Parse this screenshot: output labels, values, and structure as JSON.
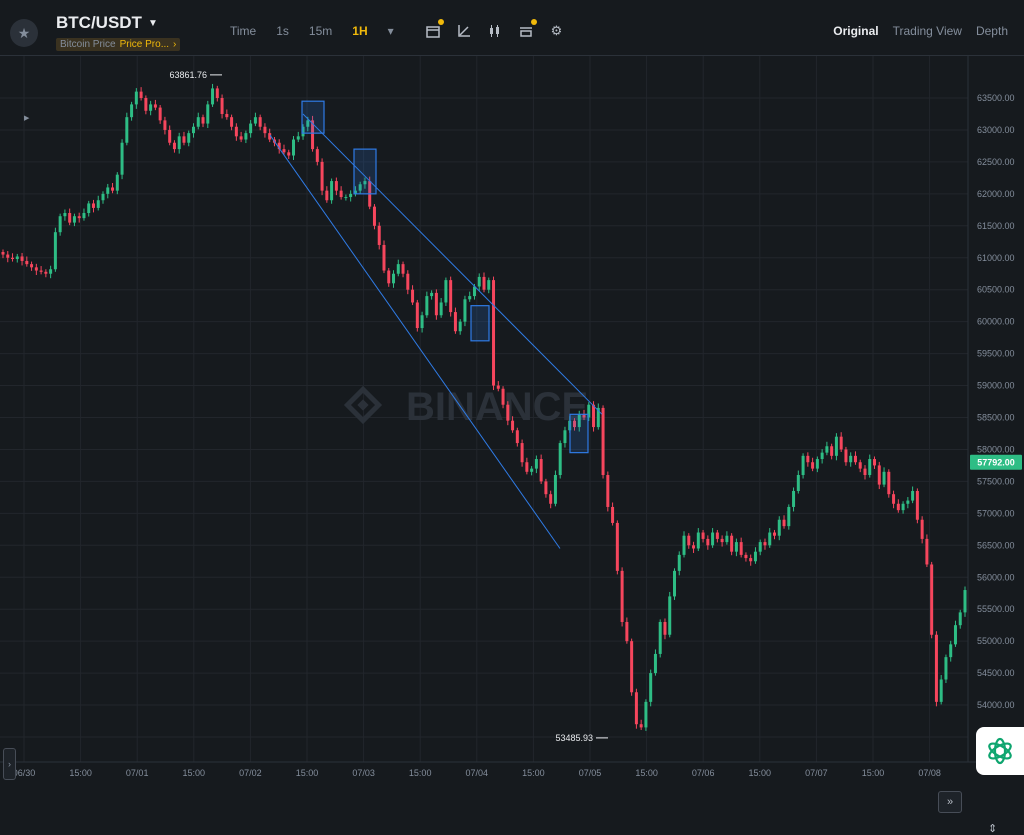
{
  "header": {
    "pair": "BTC/USDT",
    "sub_left": "Bitcoin Price",
    "sub_right": "Price Pro...",
    "intervals": [
      "Time",
      "1s",
      "15m",
      "1H"
    ],
    "active_interval": "1H",
    "views": [
      "Original",
      "Trading View",
      "Depth"
    ],
    "active_view": "Original"
  },
  "icons": {
    "favorite": "star-icon",
    "pair_menu": "caret-down-icon",
    "interval_menu": "caret-down-icon",
    "indicator": "calendar-indicator-icon",
    "drawing": "line-draw-icon",
    "candle_type": "candlestick-icon",
    "template": "template-icon",
    "settings": "gear-icon",
    "fast_forward": "double-chevron-right-icon",
    "scale": "scale-icon",
    "assistant": "ai-assistant-icon"
  },
  "colors": {
    "up": "#2ebd85",
    "down": "#f6465d",
    "accent": "#f0b90b",
    "channel": "#2f7be5"
  },
  "chart_data": {
    "type": "candlestick",
    "symbol": "BTC/USDT",
    "interval": "1H",
    "watermark": "BINANCE",
    "y_ticks": [
      63500,
      63000,
      62500,
      62000,
      61500,
      61000,
      60500,
      60000,
      59500,
      59000,
      58500,
      58000,
      57500,
      57000,
      56500,
      56000,
      55500,
      55000,
      54500,
      54000,
      53500
    ],
    "x_ticks": [
      "06/30",
      "15:00",
      "07/01",
      "15:00",
      "07/02",
      "15:00",
      "07/03",
      "15:00",
      "07/04",
      "15:00",
      "07/05",
      "15:00",
      "07/06",
      "15:00",
      "07/07",
      "15:00",
      "07/08"
    ],
    "high_label": "63861.76",
    "low_label": "53485.93",
    "last_price": "57792.00",
    "close_series": [
      61050,
      61000,
      60980,
      61020,
      60950,
      60900,
      60850,
      60800,
      60780,
      60750,
      60820,
      61400,
      61650,
      61700,
      61550,
      61650,
      61620,
      61700,
      61850,
      61780,
      61900,
      62000,
      62100,
      62050,
      62300,
      62800,
      63200,
      63400,
      63600,
      63500,
      63300,
      63400,
      63350,
      63150,
      63000,
      62800,
      62700,
      62900,
      62800,
      62950,
      63050,
      63200,
      63100,
      63400,
      63650,
      63500,
      63250,
      63200,
      63050,
      62900,
      62850,
      62950,
      63100,
      63200,
      63050,
      62950,
      62850,
      62800,
      62700,
      62650,
      62600,
      62850,
      62900,
      63050,
      63150,
      62700,
      62500,
      62050,
      61900,
      62200,
      62050,
      61950,
      61950,
      62000,
      62050,
      62150,
      62200,
      61800,
      61500,
      61200,
      60800,
      60600,
      60750,
      60900,
      60750,
      60500,
      60300,
      59900,
      60100,
      60400,
      60450,
      60100,
      60300,
      60650,
      60150,
      59850,
      60000,
      60350,
      60400,
      60550,
      60700,
      60500,
      60650,
      59000,
      58950,
      58700,
      58450,
      58300,
      58100,
      57800,
      57650,
      57700,
      57850,
      57500,
      57300,
      57150,
      57600,
      58100,
      58300,
      58450,
      58350,
      58550,
      58500,
      58700,
      58350,
      58650,
      57600,
      57100,
      56850,
      56100,
      55300,
      55000,
      54200,
      53700,
      53650,
      54050,
      54500,
      54800,
      55300,
      55100,
      55700,
      56100,
      56350,
      56650,
      56500,
      56450,
      56700,
      56600,
      56500,
      56700,
      56600,
      56550,
      56650,
      56400,
      56550,
      56350,
      56300,
      56250,
      56400,
      56550,
      56500,
      56700,
      56650,
      56900,
      56800,
      57100,
      57350,
      57600,
      57900,
      57800,
      57700,
      57850,
      57950,
      58050,
      57900,
      58200,
      58000,
      57800,
      57900,
      57800,
      57700,
      57600,
      57850,
      57750,
      57450,
      57650,
      57300,
      57150,
      57050,
      57150,
      57200,
      57350,
      56900,
      56600,
      56200,
      55100,
      54050,
      54400,
      54750,
      54950,
      55250,
      55450,
      55800
    ]
  }
}
